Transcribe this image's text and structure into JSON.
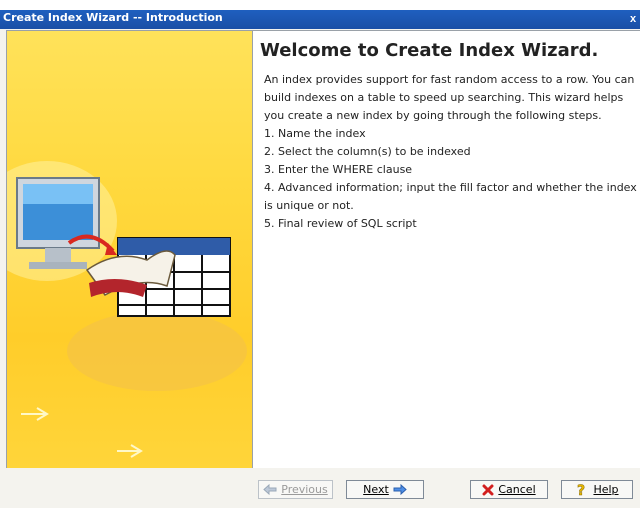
{
  "window": {
    "title": "Create Index Wizard -- Introduction"
  },
  "heading": "Welcome to Create Index Wizard.",
  "intro": "An index provides support for fast random access to a row. You can build indexes on a table to speed up searching. This wizard helps you create a new index by going through the following steps.",
  "steps": [
    "1. Name the index",
    "2. Select the column(s) to be indexed",
    "3. Enter the WHERE clause",
    "4. Advanced information; input the fill factor and whether the index is unique or not.",
    "5. Final review of SQL script"
  ],
  "buttons": {
    "previous": "Previous",
    "next": "Next",
    "cancel": "Cancel",
    "help": "Help"
  },
  "colors": {
    "accent": "#1a4fa6",
    "art_bg": "#ffd93e"
  }
}
